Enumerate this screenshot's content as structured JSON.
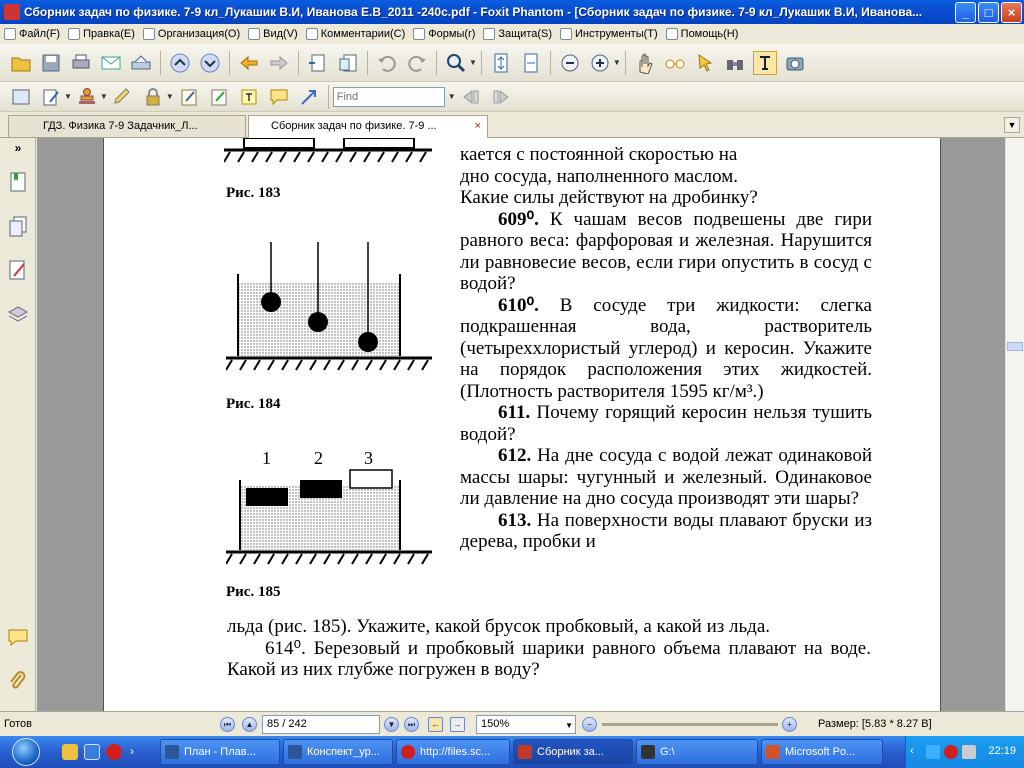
{
  "window": {
    "title": "Сборник задач по физике. 7-9 кл_Лукашик В.И, Иванова Е.В_2011 -240с.pdf - Foxit Phantom - [Сборник задач по физике. 7-9 кл_Лукашик В.И, Иванова...",
    "min_symbol": "_",
    "max_symbol": "□",
    "close_symbol": "×"
  },
  "menu": [
    {
      "label": "Файл(F)"
    },
    {
      "label": "Правка(E)"
    },
    {
      "label": "Организация(O)"
    },
    {
      "label": "Вид(V)"
    },
    {
      "label": "Комментарии(C)"
    },
    {
      "label": "Формы(r)"
    },
    {
      "label": "Защита(S)"
    },
    {
      "label": "Инструменты(T)"
    },
    {
      "label": "Помощь(H)"
    }
  ],
  "toolbar": {
    "find_placeholder": "Find"
  },
  "tabs": [
    {
      "label": "ГДЗ. Физика 7-9 Задачник_Л...",
      "active": false
    },
    {
      "label": "Сборник задач по физике. 7-9 ...",
      "active": true,
      "close": "×"
    }
  ],
  "tab_menu_symbol": "▼",
  "document": {
    "captions": {
      "fig183": "Рис. 183",
      "fig184": "Рис. 184",
      "fig185": "Рис. 185"
    },
    "fig185_labels": [
      "1",
      "2",
      "3"
    ],
    "lines_top": [
      "кается с постоянной скоростью на",
      "дно сосуда, наполненного маслом.",
      "Какие силы действуют на дробинку?"
    ],
    "p609_num": "609⁰.",
    "p609_text": " К чашам весов подвешены две гири равного веса: фарфоровая и железная. Нарушится ли равновесие весов, если гири опустить в сосуд с водой?",
    "p610_num": "610⁰.",
    "p610_text": " В сосуде три жидкости: слегка подкрашенная вода, растворитель (четыреххлористый углерод) и керосин. Укажите на порядок расположения этих жидкостей. (Плотность растворителя 1595 кг/м³.)",
    "p611_num": "611.",
    "p611_text": " Почему горящий керосин нельзя тушить водой?",
    "p612_num": "612.",
    "p612_text": " На дне сосуда с водой лежат одинаковой массы шары: чугунный и железный. Одинаковое ли давление на дно сосуда производят эти шары?",
    "p613_num": "613.",
    "p613_text_col": " На поверхности воды плавают бруски из дерева, пробки и",
    "p613_text_full": "льда (рис. 185). Укажите, какой брусок пробковый, а какой из льда.",
    "p614_num": "614⁰.",
    "p614_text": " Березовый и пробковый шарики равного объема плавают на воде. Какой из них глубже погружен в воду?"
  },
  "status": {
    "ready": "Готов",
    "page": "85 / 242",
    "zoom": "150%",
    "size": "Размер: [5.83 * 8.27 В]"
  },
  "taskbar": {
    "tasks": [
      {
        "label": "План - Плав...",
        "color": "#2f6db8"
      },
      {
        "label": "Конспект_ур...",
        "color": "#2f6db8"
      },
      {
        "label": "http://files.sc...",
        "color": "#d21f1f"
      },
      {
        "label": "Сборник за...",
        "color": "#c0392b",
        "active": true
      },
      {
        "label": "G:\\",
        "color": "#333333"
      },
      {
        "label": "Microsoft Po...",
        "color": "#d2532b"
      }
    ],
    "clock": "22:19"
  }
}
